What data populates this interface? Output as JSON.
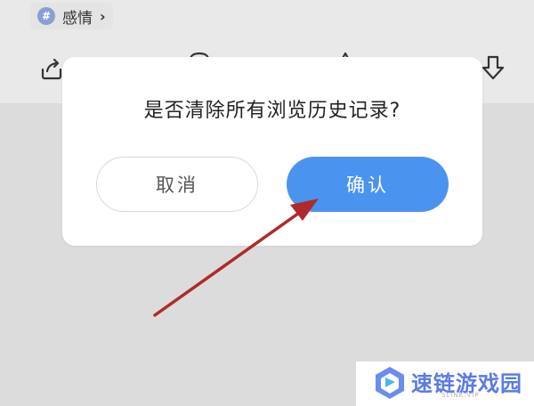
{
  "background": {
    "tag": {
      "hash": "#",
      "label": "感情",
      "chevron": "›"
    },
    "icons": [
      "share-icon",
      "chat-icon",
      "like-icon",
      "download-icon"
    ]
  },
  "dialog": {
    "message": "是否清除所有浏览历史记录?",
    "cancel_label": "取消",
    "confirm_label": "确认"
  },
  "watermark": {
    "name": "速链游戏园",
    "subtitle": "SLINK.VIP"
  },
  "colors": {
    "confirm": "#4a94ef",
    "arrow": "#b02a2a",
    "watermark": "#5a7be8"
  }
}
